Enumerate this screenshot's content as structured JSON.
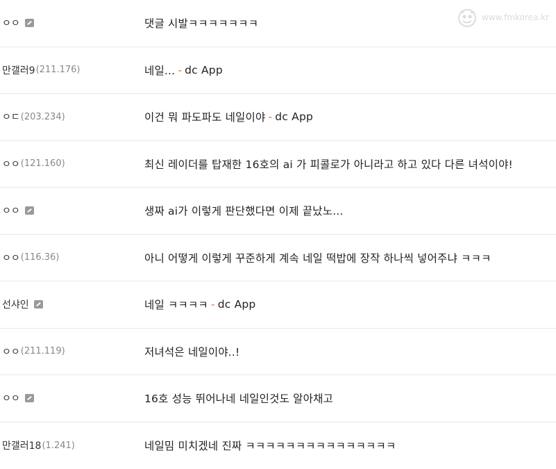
{
  "watermark": {
    "text": "www.fmkorea.kr",
    "icon": "fmkorea-logo-icon"
  },
  "comments": [
    {
      "author": "ㅇㅇ",
      "ip": "",
      "badge": true,
      "text": "댓글 시발ㅋㅋㅋㅋㅋㅋㅋ",
      "app_suffix": false
    },
    {
      "author": "만갤러9",
      "ip": "(211.176)",
      "badge": false,
      "text": "네일...",
      "app_suffix": true
    },
    {
      "author": "ㅇㄷ",
      "ip": "(203.234)",
      "badge": false,
      "text": "이건 뭐 파도파도 네일이야",
      "app_suffix": true
    },
    {
      "author": "ㅇㅇ",
      "ip": "(121.160)",
      "badge": false,
      "text": "최신 레이더를 탑재한 16호의 ai 가 피콜로가 아니라고 하고 있다 다른 녀석이야!",
      "app_suffix": false
    },
    {
      "author": "ㅇㅇ",
      "ip": "",
      "badge": true,
      "text": "생짜 ai가 이렇게 판단했다면 이제 끝났노...",
      "app_suffix": false
    },
    {
      "author": "ㅇㅇ",
      "ip": "(116.36)",
      "badge": false,
      "text": "아니 어떻게 이렇게 꾸준하게 계속 네일 떡밥에 장작 하나씩 넣어주냐 ㅋㅋㅋ",
      "app_suffix": false
    },
    {
      "author": "선샤인",
      "ip": "",
      "badge": true,
      "text": "네일 ㅋㅋㅋㅋ",
      "app_suffix": true
    },
    {
      "author": "ㅇㅇ",
      "ip": "(211.119)",
      "badge": false,
      "text": "저녀석은 네일이야..!",
      "app_suffix": false
    },
    {
      "author": "ㅇㅇ",
      "ip": "",
      "badge": true,
      "text": "16호 성능 뛰어나네 네일인것도 알아채고",
      "app_suffix": false
    },
    {
      "author": "만갤러18",
      "ip": "(1.241)",
      "badge": false,
      "text": "네일밈 미치겠네 진짜 ㅋㅋㅋㅋㅋㅋㅋㅋㅋㅋㅋㅋㅋㅋㅋ",
      "app_suffix": false
    }
  ],
  "app_suffix_text": {
    "dash": "-",
    "app": "dc App"
  }
}
